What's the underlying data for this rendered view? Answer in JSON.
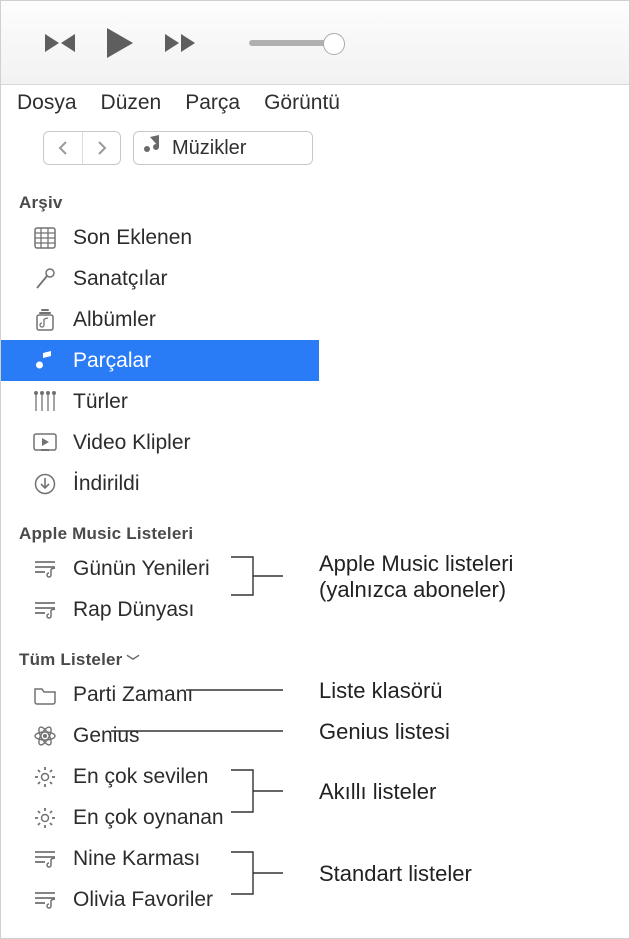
{
  "menu": {
    "file": "Dosya",
    "edit": "Düzen",
    "track": "Parça",
    "view": "Görüntü"
  },
  "nav": {
    "media_type": "Müzikler"
  },
  "sections": {
    "library": "Arşiv",
    "apple_playlists": "Apple Music Listeleri",
    "all_playlists": "Tüm Listeler"
  },
  "library_items": [
    {
      "key": "recently_added",
      "label": "Son Eklenen"
    },
    {
      "key": "artists",
      "label": "Sanatçılar"
    },
    {
      "key": "albums",
      "label": "Albümler"
    },
    {
      "key": "songs",
      "label": "Parçalar",
      "selected": true
    },
    {
      "key": "genres",
      "label": "Türler"
    },
    {
      "key": "videos",
      "label": "Video Klipler"
    },
    {
      "key": "downloaded",
      "label": "İndirildi"
    }
  ],
  "apple_playlists": [
    {
      "key": "daily_new",
      "label": "Günün Yenileri"
    },
    {
      "key": "rap_world",
      "label": "Rap Dünyası"
    }
  ],
  "all_playlists": [
    {
      "key": "party_time",
      "label": "Parti Zamanı"
    },
    {
      "key": "genius",
      "label": "Genius"
    },
    {
      "key": "most_loved",
      "label": "En çok sevilen"
    },
    {
      "key": "most_played",
      "label": "En çok oynanan"
    },
    {
      "key": "nine_mix",
      "label": "Nine Karması"
    },
    {
      "key": "olivia_favs",
      "label": "Olivia Favoriler"
    }
  ],
  "annotations": {
    "apple_music": "Apple Music listeleri\n(yalnızca aboneler)",
    "folder": "Liste klasörü",
    "genius": "Genius listesi",
    "smart": "Akıllı listeler",
    "standard": "Standart listeler"
  }
}
